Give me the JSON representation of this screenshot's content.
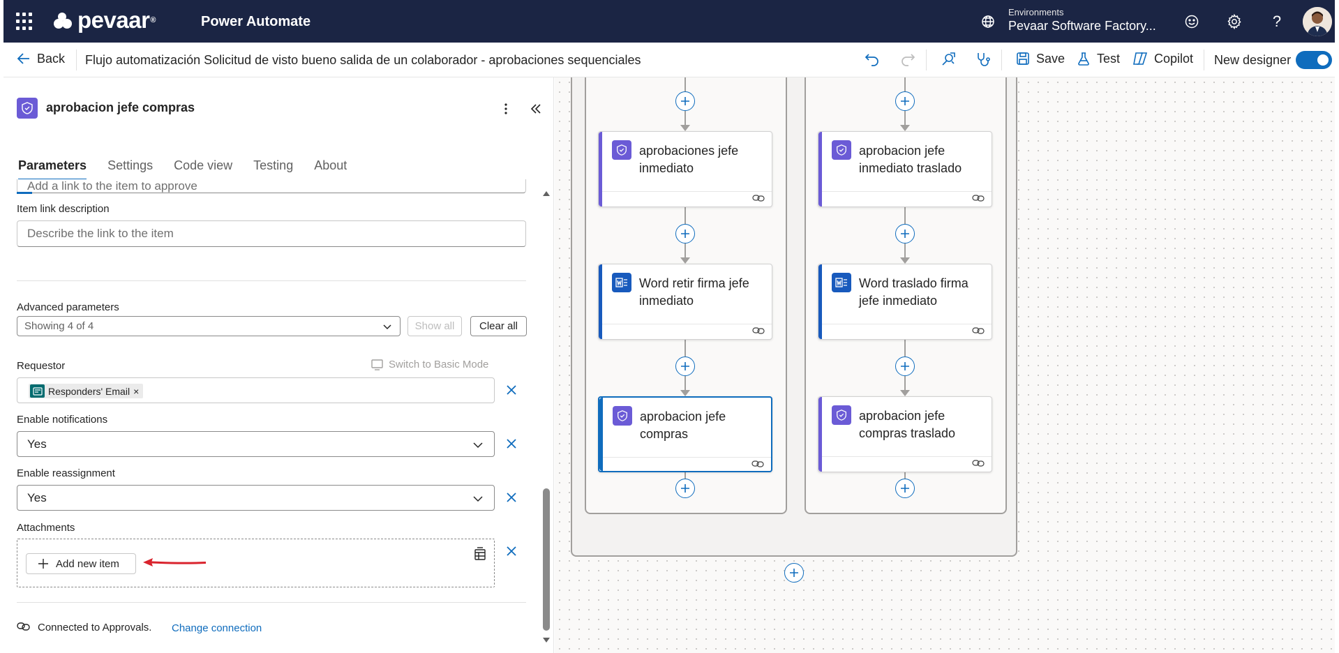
{
  "topbar": {
    "logo": "pevaar",
    "logo_mark": "®",
    "app_name": "Power Automate",
    "env_label": "Environments",
    "env_name": "Pevaar Software Factory...",
    "icons": [
      "waffle-icon",
      "environment-icon",
      "smiley-icon",
      "gear-icon",
      "help-icon",
      "avatar"
    ]
  },
  "cmdbar": {
    "back": "Back",
    "flow_title": "Flujo automatización Solicitud de visto bueno salida de un colaborador - aprobaciones sequenciales",
    "save": "Save",
    "test": "Test",
    "copilot": "Copilot",
    "new_designer": "New designer",
    "new_designer_on": true
  },
  "panel": {
    "title": "aprobacion jefe compras",
    "tabs": [
      "Parameters",
      "Settings",
      "Code view",
      "Testing",
      "About"
    ],
    "active_tab": "Parameters",
    "item_link_placeholder_clipped": "Add a link to the item to approve",
    "item_link_description_label": "Item link description",
    "item_link_description_placeholder": "Describe the link to the item",
    "advanced_label": "Advanced parameters",
    "advanced_value": "Showing 4 of 4",
    "show_all": "Show all",
    "clear_all": "Clear all",
    "requestor_label": "Requestor",
    "switch_basic": "Switch to Basic Mode",
    "requestor_token": "Responders' Email",
    "token_remove": "×",
    "notifications_label": "Enable notifications",
    "notifications_value": "Yes",
    "reassignment_label": "Enable reassignment",
    "reassignment_value": "Yes",
    "attachments_label": "Attachments",
    "add_new_item": "Add new item",
    "connected_text": "Connected to Approvals.",
    "change_connection": "Change connection"
  },
  "canvas": {
    "left_branch": [
      {
        "title": "aprobaciones jefe inmediato",
        "type": "approval"
      },
      {
        "title": "Word retir firma jefe inmediato",
        "type": "word"
      },
      {
        "title": "aprobacion jefe compras",
        "type": "approval",
        "selected": true
      }
    ],
    "right_branch": [
      {
        "title": "aprobacion jefe inmediato traslado",
        "type": "approval"
      },
      {
        "title": "Word traslado firma jefe inmediato",
        "type": "word"
      },
      {
        "title": "aprobacion jefe compras traslado",
        "type": "approval"
      }
    ]
  },
  "colors": {
    "topbar_bg": "#1b2544",
    "accent": "#0f6cbd",
    "approval_icon": "#6b5bd6",
    "word_icon": "#185abd",
    "annotation_arrow": "#d9232d"
  }
}
